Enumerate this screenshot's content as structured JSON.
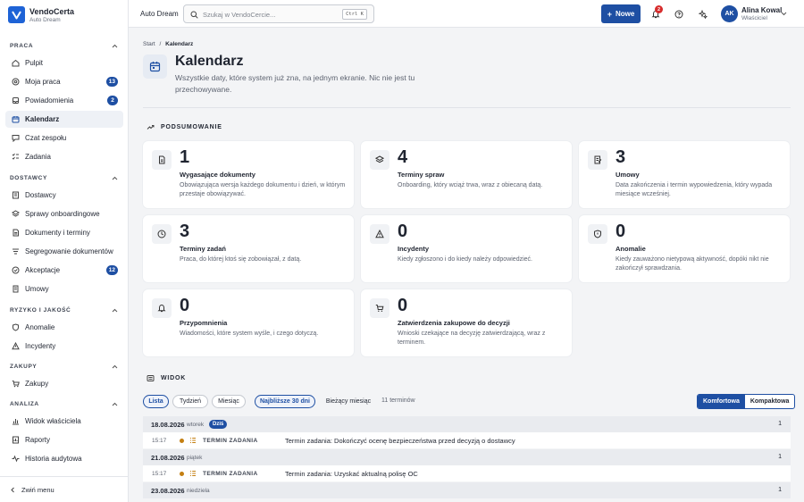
{
  "brand": {
    "name": "VendoCerta",
    "subtitle": "Auto Dream"
  },
  "sidebar": {
    "sections": [
      {
        "label": "PRACA",
        "items": [
          {
            "label": "Pulpit",
            "icon": "home-icon"
          },
          {
            "label": "Moja praca",
            "icon": "target-icon",
            "badge": "13"
          },
          {
            "label": "Powiadomienia",
            "icon": "bell-icon",
            "badge": "2"
          },
          {
            "label": "Kalendarz",
            "icon": "calendar-icon",
            "active": true
          },
          {
            "label": "Czat zespołu",
            "icon": "chat-icon"
          },
          {
            "label": "Zadania",
            "icon": "checklist-icon"
          }
        ]
      },
      {
        "label": "DOSTAWCY",
        "items": [
          {
            "label": "Dostawcy",
            "icon": "building-icon"
          },
          {
            "label": "Sprawy onboardingowe",
            "icon": "layers-icon"
          },
          {
            "label": "Dokumenty i terminy",
            "icon": "document-icon"
          },
          {
            "label": "Segregowanie dokumentów",
            "icon": "sort-icon"
          },
          {
            "label": "Akceptacje",
            "icon": "check-circle-icon",
            "badge": "12"
          },
          {
            "label": "Umowy",
            "icon": "contract-icon"
          }
        ]
      },
      {
        "label": "RYZYKO I JAKOŚĆ",
        "items": [
          {
            "label": "Anomalie",
            "icon": "shield-icon"
          },
          {
            "label": "Incydenty",
            "icon": "warning-icon"
          }
        ]
      },
      {
        "label": "ZAKUPY",
        "items": [
          {
            "label": "Zakupy",
            "icon": "cart-icon"
          }
        ]
      },
      {
        "label": "ANALIZA",
        "items": [
          {
            "label": "Widok właściciela",
            "icon": "chart-icon"
          },
          {
            "label": "Raporty",
            "icon": "report-icon"
          },
          {
            "label": "Historia audytowa",
            "icon": "activity-icon"
          }
        ]
      }
    ],
    "collapse_label": "Zwiń menu"
  },
  "topbar": {
    "org": "Auto Dream",
    "search_placeholder": "Szukaj w VendoCercie...",
    "shortcut": "Ctrl K",
    "new_label": "Nowe",
    "notifications_badge": "2",
    "user": {
      "initials": "AK",
      "name": "Alina Kowal",
      "role": "Właściciel"
    }
  },
  "breadcrumb": {
    "root": "Start",
    "separator": "/",
    "current": "Kalendarz"
  },
  "page": {
    "title": "Kalendarz",
    "description": "Wszystkie daty, które system już zna, na jednym ekranie. Nic nie jest tu przechowywane."
  },
  "summary": {
    "heading": "PODSUMOWANIE",
    "cards": [
      {
        "num": "1",
        "title": "Wygasające dokumenty",
        "desc": "Obowiązująca wersja każdego dokumentu i dzień, w którym przestaje obowiązywać.",
        "icon": "document-icon"
      },
      {
        "num": "4",
        "title": "Terminy spraw",
        "desc": "Onboarding, który wciąż trwa, wraz z obiecaną datą.",
        "icon": "layers-icon"
      },
      {
        "num": "3",
        "title": "Umowy",
        "desc": "Data zakończenia i termin wypowiedzenia, który wypada miesiące wcześniej.",
        "icon": "contract-icon"
      },
      {
        "num": "3",
        "title": "Terminy zadań",
        "desc": "Praca, do której ktoś się zobowiązał, z datą.",
        "icon": "clock-icon"
      },
      {
        "num": "0",
        "title": "Incydenty",
        "desc": "Kiedy zgłoszono i do kiedy należy odpowiedzieć.",
        "icon": "warning-icon"
      },
      {
        "num": "0",
        "title": "Anomalie",
        "desc": "Kiedy zauważono nietypową aktywność, dopóki nikt nie zakończył sprawdzania.",
        "icon": "shield-icon"
      },
      {
        "num": "0",
        "title": "Przypomnienia",
        "desc": "Wiadomości, które system wyśle, i czego dotyczą.",
        "icon": "bell-icon"
      },
      {
        "num": "0",
        "title": "Zatwierdzenia zakupowe do decyzji",
        "desc": "Wnioski czekające na decyzję zatwierdzającą, wraz z terminem.",
        "icon": "cart-icon"
      }
    ]
  },
  "view": {
    "heading": "WIDOK",
    "modes": [
      "Lista",
      "Tydzień",
      "Miesiąc"
    ],
    "active_mode": "Lista",
    "ranges": [
      "Najbliższe 30 dni",
      "Bieżący miesiąc"
    ],
    "active_range": "Najbliższe 30 dni",
    "count": "11 terminów",
    "density": [
      "Komfortowa",
      "Kompaktowa"
    ],
    "active_density": "Komfortowa"
  },
  "agenda": {
    "days": [
      {
        "date": "18.08.2026",
        "weekday": "wtorek",
        "today_label": "Dziś",
        "count": "1",
        "events": [
          {
            "time": "15:17",
            "kind": "TERMIN ZADANIA",
            "text": "Termin zadania: Dokończyć ocenę bezpieczeństwa przed decyzją o dostawcy"
          }
        ]
      },
      {
        "date": "21.08.2026",
        "weekday": "piątek",
        "count": "1",
        "events": [
          {
            "time": "15:17",
            "kind": "TERMIN ZADANIA",
            "text": "Termin zadania: Uzyskać aktualną polisę OC"
          }
        ]
      },
      {
        "date": "23.08.2026",
        "weekday": "niedziela",
        "count": "1",
        "events": []
      }
    ]
  },
  "colors": {
    "accent": "#1e4fa3",
    "brand": "#1e63d6",
    "event_dot": "#c47f12",
    "alert": "#d72c2c"
  }
}
